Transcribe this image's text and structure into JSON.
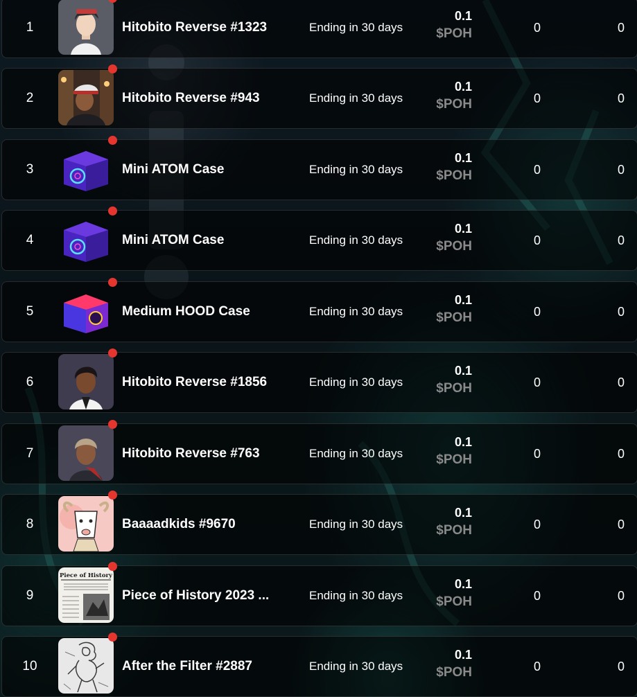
{
  "rows": [
    {
      "rank": "1",
      "name": "Hitobito Reverse #1323",
      "ending": "Ending in 30 days",
      "price": "0.1",
      "token": "$POH",
      "stat_a": "0",
      "stat_b": "0",
      "thumb_icon": "hitobito-avatar-icon"
    },
    {
      "rank": "2",
      "name": "Hitobito Reverse #943",
      "ending": "Ending in 30 days",
      "price": "0.1",
      "token": "$POH",
      "stat_a": "0",
      "stat_b": "0",
      "thumb_icon": "hitobito-avatar-icon"
    },
    {
      "rank": "3",
      "name": "Mini ATOM Case",
      "ending": "Ending in 30 days",
      "price": "0.1",
      "token": "$POH",
      "stat_a": "0",
      "stat_b": "0",
      "thumb_icon": "atom-case-icon"
    },
    {
      "rank": "4",
      "name": "Mini ATOM Case",
      "ending": "Ending in 30 days",
      "price": "0.1",
      "token": "$POH",
      "stat_a": "0",
      "stat_b": "0",
      "thumb_icon": "atom-case-icon"
    },
    {
      "rank": "5",
      "name": "Medium HOOD Case",
      "ending": "Ending in 30 days",
      "price": "0.1",
      "token": "$POH",
      "stat_a": "0",
      "stat_b": "0",
      "thumb_icon": "hood-case-icon"
    },
    {
      "rank": "6",
      "name": "Hitobito Reverse #1856",
      "ending": "Ending in 30 days",
      "price": "0.1",
      "token": "$POH",
      "stat_a": "0",
      "stat_b": "0",
      "thumb_icon": "hitobito-avatar-icon"
    },
    {
      "rank": "7",
      "name": "Hitobito Reverse #763",
      "ending": "Ending in 30 days",
      "price": "0.1",
      "token": "$POH",
      "stat_a": "0",
      "stat_b": "0",
      "thumb_icon": "hitobito-avatar-icon"
    },
    {
      "rank": "8",
      "name": "Baaaadkids #9670",
      "ending": "Ending in 30 days",
      "price": "0.1",
      "token": "$POH",
      "stat_a": "0",
      "stat_b": "0",
      "thumb_icon": "goat-avatar-icon"
    },
    {
      "rank": "9",
      "name": "Piece of History 2023 ...",
      "ending": "Ending in 30 days",
      "price": "0.1",
      "token": "$POH",
      "stat_a": "0",
      "stat_b": "0",
      "thumb_icon": "newspaper-icon",
      "thumb_text": "Piece of History"
    },
    {
      "rank": "10",
      "name": "After the Filter #2887",
      "ending": "Ending in 30 days",
      "price": "0.1",
      "token": "$POH",
      "stat_a": "0",
      "stat_b": "0",
      "thumb_icon": "sketch-figure-icon"
    }
  ],
  "colors": {
    "badge_dot": "#e5352f",
    "token_text": "#8a8a8a",
    "row_border": "#2a2e33"
  }
}
